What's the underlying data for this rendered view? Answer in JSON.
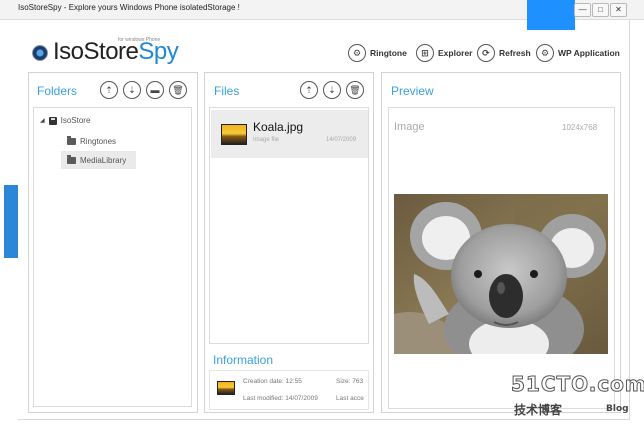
{
  "window": {
    "title": "IsoStoreSpy - Explore yours Windows Phone isolatedStorage !",
    "minimize_glyph": "—",
    "maximize_glyph": "□",
    "close_glyph": "✕"
  },
  "logo": {
    "part1": "IsoStore",
    "part2": "Spy",
    "subtitle": "for windows Phone",
    "icon": "eye-icon"
  },
  "toolbar": {
    "items": [
      {
        "label": "Ringtone",
        "icon": "gear-icon",
        "glyph": "⚙"
      },
      {
        "label": "Explorer",
        "icon": "windows-icon",
        "glyph": "⊞"
      },
      {
        "label": "Refresh",
        "icon": "refresh-icon",
        "glyph": "⟳"
      },
      {
        "label": "WP Application",
        "icon": "gear-icon",
        "glyph": "⚙"
      }
    ]
  },
  "folders": {
    "title": "Folders",
    "actions": [
      {
        "icon": "upload-icon",
        "glyph": "⇡"
      },
      {
        "icon": "download-icon",
        "glyph": "⇣"
      },
      {
        "icon": "new-folder-icon",
        "glyph": "▬"
      },
      {
        "icon": "delete-icon",
        "glyph": "🗑"
      }
    ],
    "tree": {
      "expander": "◢",
      "root": "IsoStore",
      "children": [
        "Ringtones",
        "MediaLibrary"
      ],
      "selected": "MediaLibrary"
    }
  },
  "files": {
    "title": "Files",
    "actions": [
      {
        "icon": "upload-icon",
        "glyph": "⇡"
      },
      {
        "icon": "download-icon",
        "glyph": "⇣"
      },
      {
        "icon": "delete-icon",
        "glyph": "🗑"
      }
    ],
    "items": [
      {
        "name": "Koala.jpg",
        "type": "Image file",
        "date": "14/07/2009"
      }
    ]
  },
  "information": {
    "title": "Information",
    "creation_label": "Creation date:",
    "creation_value": "12:55",
    "modified_label": "Last modified:",
    "modified_value": "14/07/2009",
    "size_label": "Size:",
    "size_value": "763",
    "access_label": "Last acce"
  },
  "preview": {
    "title": "Preview",
    "kind": "Image",
    "dimensions": "1024x768"
  },
  "watermark": {
    "line1": "51CTO.com",
    "line2": "技术博客",
    "line3": "Blog"
  },
  "colors": {
    "accent": "#2188d6",
    "panel_title": "#3aa0e0"
  }
}
